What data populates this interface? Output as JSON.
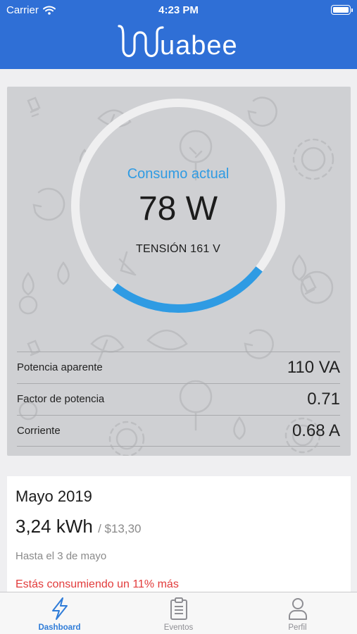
{
  "status_bar": {
    "carrier": "Carrier",
    "time": "4:23 PM",
    "wifi_icon": "wifi-icon",
    "battery_icon": "battery-icon"
  },
  "header": {
    "logo_text": "Wuabee",
    "background": "#2f6fd6"
  },
  "gauge": {
    "label": "Consumo actual",
    "value": "78 W",
    "tension": "TENSIÓN 161 V",
    "level": 0.25,
    "accent": "#2f9be3"
  },
  "metrics": [
    {
      "label": "Potencia aparente",
      "value": "110 VA"
    },
    {
      "label": "Factor de potencia",
      "value": "0.71"
    },
    {
      "label": "Corriente",
      "value": "0.68 A"
    }
  ],
  "month": {
    "title": "Mayo 2019",
    "kwh": "3,24 kWh",
    "cost": "/ $13,30",
    "until": "Hasta el 3 de mayo",
    "alert": "Estás consumiendo un 11% más",
    "alert_color": "#e23b3b"
  },
  "tabs": [
    {
      "label": "Dashboard",
      "icon": "lightning-icon",
      "active": true
    },
    {
      "label": "Eventos",
      "icon": "clipboard-icon",
      "active": false
    },
    {
      "label": "Perfil",
      "icon": "user-icon",
      "active": false
    }
  ]
}
